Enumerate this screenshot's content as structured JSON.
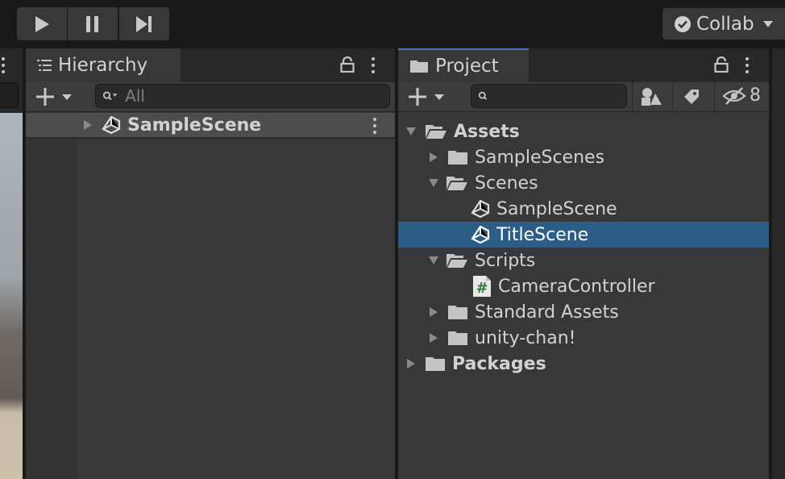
{
  "toolbar": {
    "play_icon": "play-icon",
    "pause_icon": "pause-icon",
    "step_icon": "step-icon",
    "collab_label": "Collab"
  },
  "hierarchy": {
    "tab_label": "Hierarchy",
    "search_placeholder": "All",
    "rows": [
      {
        "label": "SampleScene"
      }
    ]
  },
  "project": {
    "tab_label": "Project",
    "hidden_count": "8",
    "tree": [
      {
        "label": "Assets",
        "bold": true
      },
      {
        "label": "SampleScenes"
      },
      {
        "label": "Scenes"
      },
      {
        "label": "SampleScene"
      },
      {
        "label": "TitleScene"
      },
      {
        "label": "Scripts"
      },
      {
        "label": "CameraController"
      },
      {
        "label": "Standard Assets"
      },
      {
        "label": "unity-chan!"
      },
      {
        "label": "Packages",
        "bold": true
      }
    ]
  },
  "colors": {
    "selection": "#2c5d87",
    "panel_bg": "#383838",
    "toolbar_bg": "#191919"
  }
}
